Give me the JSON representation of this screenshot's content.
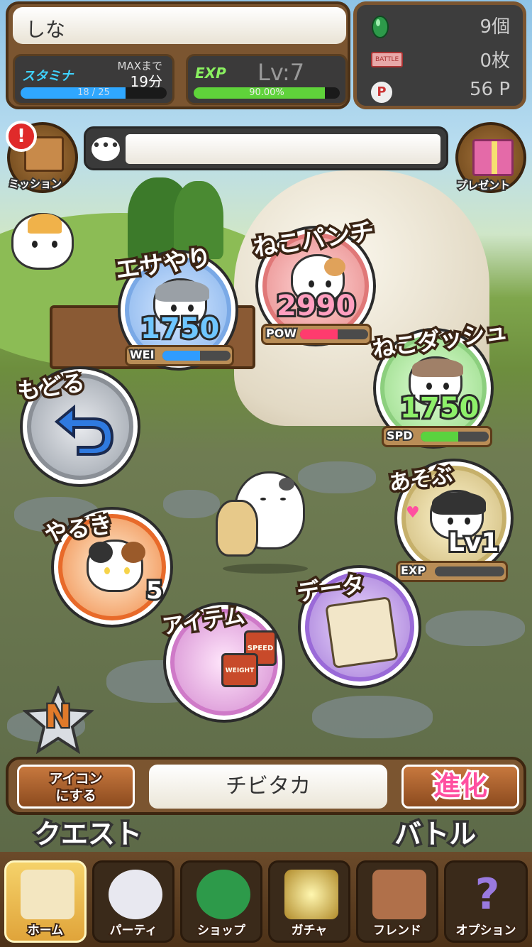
{
  "player": {
    "name": "しな"
  },
  "stamina": {
    "label": "スタミナ",
    "max_label": "MAXまで",
    "max_time": "19分",
    "text": "18 / 25",
    "value": 18,
    "max": 25
  },
  "exp": {
    "label": "EXP",
    "level": "Lv:7",
    "text": "90.00%",
    "percent": 90
  },
  "resources": {
    "gems": "9個",
    "tickets": "0枚",
    "points": "56 P",
    "ticket_icon_text": "BATTLE",
    "points_icon_text": "P"
  },
  "side": {
    "mission": "ミッション",
    "present": "プレゼント",
    "alert": "!"
  },
  "actions": {
    "feed": {
      "title": "エサやり",
      "value": "1750",
      "stat": "WEI",
      "fill": 0.55
    },
    "punch": {
      "title": "ねこパンチ",
      "value": "2990",
      "stat": "POW",
      "fill": 0.55
    },
    "dash": {
      "title": "ねこダッシュ",
      "value": "1750",
      "stat": "SPD",
      "fill": 0.55
    },
    "play": {
      "title": "あそぶ",
      "value": "Lv1",
      "stat": "EXP",
      "fill": 0
    },
    "back": {
      "title": "もどる"
    },
    "motivation": {
      "title": "やるき",
      "value": "5"
    },
    "item": {
      "title": "アイテム",
      "can1": "SPEED",
      "can2": "WEIGHT"
    },
    "data": {
      "title": "データ"
    }
  },
  "rank_badge": "N",
  "bottom": {
    "icon_button": "アイコン\nにする",
    "pet_name": "チビタカ",
    "evolve": "進化",
    "quest": "クエスト",
    "battle": "バトル"
  },
  "nav": [
    "ホーム",
    "パーティ",
    "ショップ",
    "ガチャ",
    "フレンド",
    "オプション"
  ],
  "colors": {
    "stamina": "#2fa7ff",
    "exp": "#5fd33a",
    "pow": "#ff3b6e",
    "wei": "#2f9cff",
    "spd": "#5ad33f"
  }
}
